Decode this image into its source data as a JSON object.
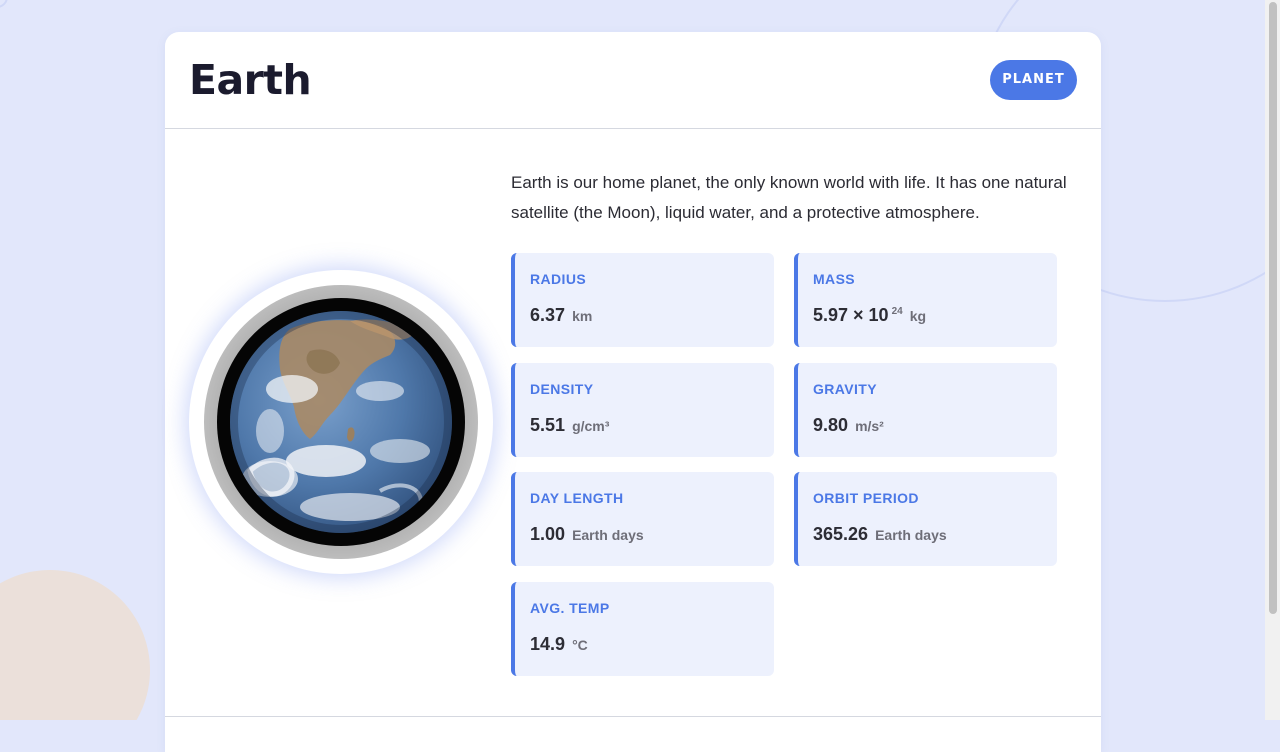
{
  "header": {
    "title": "Earth",
    "badge": "PLANET"
  },
  "planet_image": {
    "icon": "earth-globe-image"
  },
  "description": "Earth is our home planet, the only known world with life. It has one natural satellite (the Moon), liquid water, and a protective atmosphere.",
  "stats": {
    "radius": {
      "label": "RADIUS",
      "value": "6.37",
      "unit": "km"
    },
    "mass": {
      "label": "MASS",
      "value": "5.97 × 10",
      "exponent": "24",
      "unit": "kg"
    },
    "density": {
      "label": "DENSITY",
      "value": "5.51",
      "unit": "g/cm³"
    },
    "gravity": {
      "label": "GRAVITY",
      "value": "9.80",
      "unit": "m/s²"
    },
    "day_length": {
      "label": "DAY LENGTH",
      "value": "1.00",
      "unit": "Earth days"
    },
    "orbit_period": {
      "label": "ORBIT PERIOD",
      "value": "365.26",
      "unit": "Earth days"
    },
    "avg_temp": {
      "label": "AVG. TEMP",
      "value": "14.9",
      "unit": "°C"
    }
  },
  "colors": {
    "accent": "#4b78e6",
    "background": "#e2e7fb",
    "stat_card": "#edf1fd",
    "title": "#1b1b2e"
  }
}
